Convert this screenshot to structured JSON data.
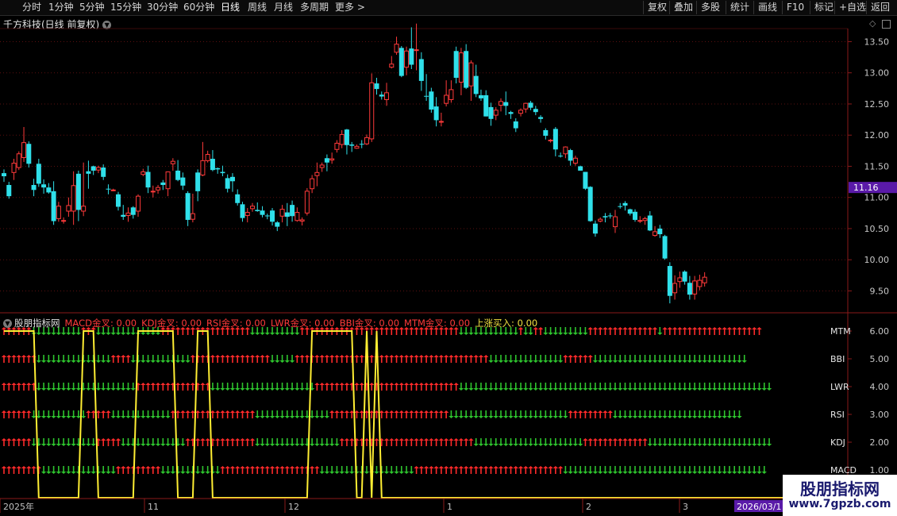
{
  "tabs": [
    {
      "label": "分时",
      "x": 28
    },
    {
      "label": "1分钟",
      "x": 61
    },
    {
      "label": "5分钟",
      "x": 100
    },
    {
      "label": "15分钟",
      "x": 139
    },
    {
      "label": "30分钟",
      "x": 185
    },
    {
      "label": "60分钟",
      "x": 231
    },
    {
      "label": "日线",
      "x": 278,
      "active": true
    },
    {
      "label": "周线",
      "x": 312
    },
    {
      "label": "月线",
      "x": 345
    },
    {
      "label": "多周期",
      "x": 378
    },
    {
      "label": "更多 >",
      "x": 422
    }
  ],
  "toolbar": [
    {
      "label": "复权",
      "x": 816
    },
    {
      "label": "叠加",
      "x": 849
    },
    {
      "label": "多股",
      "x": 883
    },
    {
      "label": "统计",
      "x": 920
    },
    {
      "label": "画线",
      "x": 955
    },
    {
      "label": "F10",
      "x": 991
    },
    {
      "label": "标记",
      "x": 1026
    },
    {
      "label": "+自选",
      "x": 1057
    },
    {
      "label": "返回",
      "x": 1097
    }
  ],
  "stock_title": "千方科技(日线 前复权)",
  "price_axis": [
    "13.50",
    "13.00",
    "12.50",
    "12.00",
    "11.50",
    "11.00",
    "10.50",
    "10.00",
    "9.50"
  ],
  "current_price": "11.16",
  "indicator": {
    "name": "股朋指标网",
    "fields": [
      {
        "label": "MACD金叉: 0.00",
        "color": "#ff3a3a"
      },
      {
        "label": "KDJ金叉: 0.00",
        "color": "#ff3a3a"
      },
      {
        "label": "RSI金叉: 0.00",
        "color": "#ff3a3a"
      },
      {
        "label": "LWR金叉: 0.00",
        "color": "#ff3a3a"
      },
      {
        "label": "BBI金叉: 0.00",
        "color": "#ff3a3a"
      },
      {
        "label": "MTM金叉: 0.00",
        "color": "#ff3a3a"
      },
      {
        "label": "上涨买入: 0.00",
        "color": "#f0e040"
      }
    ],
    "axis": [
      "6.00",
      "5.00",
      "4.00",
      "3.00",
      "2.00",
      "1.00"
    ],
    "row_labels": [
      "MTM",
      "BBI",
      "LWR",
      "RSI",
      "KDJ",
      "MACD"
    ]
  },
  "date_axis": [
    {
      "label": "2025年",
      "x": 4
    },
    {
      "label": "11",
      "x": 186
    },
    {
      "label": "12",
      "x": 363
    },
    {
      "label": "1",
      "x": 563
    },
    {
      "label": "2",
      "x": 738
    },
    {
      "label": "3",
      "x": 860
    }
  ],
  "date_highlight": "2026/03/1",
  "watermark": {
    "line1": "股朋指标网",
    "line2": "www.7gpzb.com"
  },
  "colors": {
    "up": "#ff3a3a",
    "down": "#2fe0ea",
    "arrow_up": "#ff2a2a",
    "arrow_down": "#2ec42e",
    "signal": "#ffee33",
    "grid": "#5a0f0f",
    "price_tag": "#5a1aa8"
  },
  "chart_data": {
    "type": "candlestick",
    "ylim": [
      9.2,
      13.85
    ],
    "candles": [
      [
        11.39,
        11.34,
        11.45,
        11.25
      ],
      [
        11.2,
        11.02,
        11.25,
        10.98
      ],
      [
        11.4,
        11.55,
        11.62,
        11.28
      ],
      [
        11.48,
        11.7,
        11.74,
        11.44
      ],
      [
        11.64,
        11.88,
        12.13,
        11.57
      ],
      [
        11.86,
        11.54,
        11.9,
        11.48
      ],
      [
        11.2,
        11.12,
        11.3,
        11.02
      ],
      [
        11.54,
        11.22,
        11.62,
        11.17
      ],
      [
        11.21,
        11.16,
        11.29,
        11.06
      ],
      [
        11.16,
        11.08,
        11.23,
        11.06
      ],
      [
        11.1,
        10.62,
        11.26,
        10.56
      ],
      [
        10.66,
        10.86,
        10.93,
        10.61
      ],
      [
        10.62,
        10.63,
        10.68,
        10.58
      ],
      [
        10.78,
        10.87,
        11.0,
        10.69
      ],
      [
        10.78,
        11.19,
        11.42,
        10.56
      ],
      [
        11.38,
        10.8,
        11.43,
        10.62
      ],
      [
        10.78,
        10.86,
        11.56,
        10.7
      ],
      [
        11.42,
        11.38,
        11.59,
        11.14
      ],
      [
        11.5,
        11.43,
        11.51,
        11.36
      ],
      [
        11.44,
        11.48,
        11.51,
        11.39
      ],
      [
        11.48,
        11.33,
        11.53,
        11.28
      ],
      [
        11.14,
        11.13,
        11.21,
        11.05
      ],
      [
        11.12,
        11.12,
        11.14,
        11.1
      ],
      [
        11.05,
        10.85,
        11.09,
        10.79
      ],
      [
        10.72,
        10.69,
        10.88,
        10.64
      ],
      [
        10.71,
        10.75,
        10.84,
        10.61
      ],
      [
        10.84,
        10.72,
        10.86,
        10.66
      ],
      [
        10.78,
        11.02,
        11.05,
        10.69
      ],
      [
        11.37,
        11.41,
        11.46,
        11.34
      ],
      [
        11.41,
        11.16,
        11.51,
        11.07
      ],
      [
        11.09,
        11.1,
        11.19,
        11.0
      ],
      [
        11.12,
        11.16,
        11.2,
        11.06
      ],
      [
        11.24,
        11.2,
        11.28,
        11.12
      ],
      [
        11.14,
        11.41,
        11.41,
        11.02
      ],
      [
        11.54,
        11.58,
        11.63,
        11.43
      ],
      [
        11.43,
        11.28,
        11.6,
        11.26
      ],
      [
        11.32,
        11.19,
        11.4,
        11.12
      ],
      [
        11.07,
        10.64,
        11.1,
        10.54
      ],
      [
        10.65,
        10.74,
        11.06,
        10.6
      ],
      [
        11.4,
        11.1,
        11.45,
        10.94
      ],
      [
        11.36,
        11.59,
        11.89,
        11.34
      ],
      [
        11.59,
        11.69,
        11.75,
        11.56
      ],
      [
        11.62,
        11.44,
        11.76,
        11.42
      ],
      [
        11.47,
        11.45,
        11.48,
        11.38
      ],
      [
        11.41,
        11.39,
        11.51,
        11.34
      ],
      [
        11.31,
        11.14,
        11.37,
        11.08
      ],
      [
        11.33,
        11.26,
        11.39,
        11.09
      ],
      [
        11.05,
        10.91,
        11.13,
        10.87
      ],
      [
        10.89,
        10.67,
        10.93,
        10.61
      ],
      [
        10.71,
        10.76,
        10.83,
        10.6
      ],
      [
        10.82,
        10.86,
        10.91,
        10.77
      ],
      [
        10.8,
        10.78,
        10.92,
        10.77
      ],
      [
        10.79,
        10.72,
        10.86,
        10.68
      ],
      [
        10.71,
        10.7,
        10.74,
        10.65
      ],
      [
        10.79,
        10.61,
        10.83,
        10.55
      ],
      [
        10.6,
        10.53,
        10.62,
        10.46
      ],
      [
        10.7,
        10.81,
        10.88,
        10.6
      ],
      [
        10.76,
        10.69,
        10.91,
        10.54
      ],
      [
        10.88,
        10.7,
        10.95,
        10.61
      ],
      [
        10.63,
        10.76,
        10.84,
        10.61
      ],
      [
        10.62,
        10.64,
        10.68,
        10.55
      ],
      [
        10.75,
        11.1,
        11.15,
        10.71
      ],
      [
        11.14,
        11.3,
        11.36,
        11.07
      ],
      [
        11.35,
        11.4,
        11.56,
        11.18
      ],
      [
        11.48,
        11.52,
        11.56,
        11.41
      ],
      [
        11.63,
        11.56,
        11.69,
        11.42
      ],
      [
        11.6,
        11.62,
        11.72,
        11.54
      ],
      [
        11.77,
        11.87,
        11.92,
        11.72
      ],
      [
        11.85,
        12.01,
        12.08,
        11.79
      ],
      [
        12.09,
        11.84,
        12.1,
        11.69
      ],
      [
        11.85,
        11.83,
        11.89,
        11.73
      ],
      [
        11.79,
        11.82,
        11.85,
        11.78
      ],
      [
        11.86,
        11.85,
        11.92,
        11.79
      ],
      [
        11.86,
        11.96,
        12.01,
        11.84
      ],
      [
        11.94,
        12.84,
        12.99,
        11.89
      ],
      [
        12.83,
        12.74,
        12.92,
        12.65
      ],
      [
        12.65,
        12.62,
        12.7,
        12.57
      ],
      [
        12.57,
        12.68,
        12.84,
        12.47
      ],
      [
        13.09,
        13.14,
        13.27,
        13.07
      ],
      [
        13.33,
        13.46,
        13.58,
        13.29
      ],
      [
        13.4,
        12.95,
        13.43,
        12.93
      ],
      [
        13.09,
        13.35,
        13.42,
        12.96
      ],
      [
        13.39,
        13.13,
        13.73,
        13.06
      ],
      [
        13.37,
        13.37,
        13.79,
        13.04
      ],
      [
        13.22,
        12.87,
        13.33,
        12.71
      ],
      [
        12.63,
        12.62,
        12.98,
        12.55
      ],
      [
        12.7,
        12.41,
        12.76,
        12.36
      ],
      [
        12.46,
        12.24,
        12.61,
        12.14
      ],
      [
        12.21,
        12.22,
        12.36,
        12.14
      ],
      [
        12.51,
        12.64,
        12.88,
        12.46
      ],
      [
        12.57,
        12.73,
        12.88,
        12.52
      ],
      [
        13.35,
        12.92,
        13.42,
        12.83
      ],
      [
        12.85,
        13.32,
        13.4,
        12.64
      ],
      [
        13.35,
        12.76,
        13.46,
        12.74
      ],
      [
        12.79,
        13.16,
        13.2,
        12.55
      ],
      [
        12.95,
        12.66,
        13.13,
        12.61
      ],
      [
        12.64,
        12.59,
        12.73,
        12.55
      ],
      [
        12.64,
        12.3,
        12.72,
        12.3
      ],
      [
        12.45,
        12.26,
        12.52,
        12.15
      ],
      [
        12.32,
        12.4,
        12.45,
        12.24
      ],
      [
        12.48,
        12.54,
        12.59,
        12.38
      ],
      [
        12.53,
        12.47,
        12.7,
        12.32
      ],
      [
        12.37,
        12.34,
        12.39,
        12.26
      ],
      [
        12.22,
        12.11,
        12.27,
        12.05
      ],
      [
        12.35,
        12.4,
        12.43,
        12.3
      ],
      [
        12.42,
        12.51,
        12.52,
        12.36
      ],
      [
        12.52,
        12.44,
        12.55,
        12.4
      ],
      [
        12.42,
        12.37,
        12.47,
        12.32
      ],
      [
        12.29,
        12.26,
        12.32,
        12.2
      ],
      [
        12.08,
        11.99,
        12.11,
        11.93
      ],
      [
        11.91,
        11.92,
        11.94,
        11.88
      ],
      [
        12.1,
        11.77,
        12.13,
        11.66
      ],
      [
        11.67,
        11.66,
        11.72,
        11.64
      ],
      [
        11.7,
        11.81,
        11.82,
        11.63
      ],
      [
        11.76,
        11.59,
        11.78,
        11.51
      ],
      [
        11.55,
        11.63,
        11.67,
        11.51
      ],
      [
        11.5,
        11.43,
        11.51,
        11.43
      ],
      [
        11.41,
        11.14,
        11.41,
        11.12
      ],
      [
        11.17,
        10.62,
        11.18,
        10.61
      ],
      [
        10.58,
        10.42,
        10.63,
        10.37
      ],
      [
        10.62,
        10.65,
        10.68,
        10.6
      ],
      [
        10.7,
        10.68,
        10.75,
        10.6
      ],
      [
        10.71,
        10.7,
        10.75,
        10.66
      ],
      [
        10.53,
        10.69,
        10.8,
        10.43
      ],
      [
        10.86,
        10.85,
        10.91,
        10.82
      ],
      [
        10.91,
        10.87,
        10.94,
        10.79
      ],
      [
        10.81,
        10.74,
        10.82,
        10.71
      ],
      [
        10.77,
        10.64,
        10.81,
        10.61
      ],
      [
        10.62,
        10.63,
        10.7,
        10.59
      ],
      [
        10.63,
        10.66,
        10.69,
        10.56
      ],
      [
        10.71,
        10.47,
        10.78,
        10.46
      ],
      [
        10.39,
        10.45,
        10.54,
        10.37
      ],
      [
        10.5,
        10.41,
        10.56,
        10.35
      ],
      [
        10.38,
        10.02,
        10.4,
        10.0
      ],
      [
        9.9,
        9.42,
        9.96,
        9.3
      ],
      [
        9.47,
        9.62,
        9.75,
        9.36
      ],
      [
        9.65,
        9.71,
        9.81,
        9.55
      ],
      [
        9.81,
        9.65,
        9.83,
        9.6
      ],
      [
        9.63,
        9.44,
        9.74,
        9.36
      ],
      [
        9.45,
        9.66,
        9.74,
        9.36
      ],
      [
        9.57,
        9.67,
        9.76,
        9.51
      ],
      [
        9.63,
        9.72,
        9.8,
        9.57
      ]
    ]
  },
  "signals": {
    "rows": [
      {
        "name": "MTM",
        "arrows": "UUUUUUDDDDDDDDDDUUUDDDDDDDDDDDDDUUUUUUUUUUUUUUUUUUDDDDDDDDDDUUUUUUUUUUUUUUUUUUUUUUUUUUUUUUUUDDDDDDDDDDDDUDDUUDDDDDDDDDUUUUUUUUUUUUUUDUUUUUUUUUUUUUUUUUUUU"
      },
      {
        "name": "BBI",
        "arrows": "UUUUUUUDDDDDDDDDDDDDDDUUUUDDDDDDDDDDDDUUUUUUUUUUUUUUUUDDDDDUUUUUUUUUUUUUUUUUUUUUUUUUUUUUUUUUUUUUUUDDDDDDDDDDDDDDDUUUUUUDDDDDDDDDDDDDDDDDDDDDDDDDDDDDDD"
      },
      {
        "name": "LWR",
        "arrows": "UUUUUUUDDDDDDDDDDDDDDDDDDDDUUUUUUUUUUUUUUUDDDDDDDDDDDDDDDDDDDDDUUUUUUUUUUUUUUUUUUUUUUUUUUUUUDDDDDDDDDDDDDDDDDDDDDDDDDDDDDDDDDDDDDDDDDDDDDDDDDDDDDDDDDDDDDDD"
      },
      {
        "name": "RSI",
        "arrows": "UUUUUUDDDDDDDDDDDUUUUUDDDDDDDDDDDDUUUUUUUUUUUUUUUUUDDDDDDDDDDDDDDDUUUUUUUUUUUUUUUUUUUUUUUUDDDDDDDDDDDDDDDDDDDDDDDDUUUUUUUUUDDDDDDDDDDDDDDDDDDDDDDDDDD"
      },
      {
        "name": "KDJ",
        "arrows": "UUUUUUDDDDDDDDDDDDDUUUUUDDDDDDDDDDDDDUUUUUUUUUUUUUUDDDDDDDDDDDDDDDDDUUUUUUUUUUUUUUUUUUUUUUUUUUUDDDDDDDDDDDDDDDDDDDDDDUUUUUUUUUUUUUDDDDDDDDDDDDDDDDDDDDDDDDD"
      },
      {
        "name": "MACD",
        "arrows": "UUUUUUUUDDDDDDDDDDDDDDDUUUUUUUUUDDDDDDDDDDDDUUUUUUUUUUUUUUUUUUUUDDDDDDDDDDDDDDDDDDDUUUUUUUUUUUUUUUUUUUUUUUUUUUUUUDDDDDDDDDDDDDDDDDDDDDDDDDDDDDDDDDDDDDDDDD"
      }
    ],
    "buy_signal": [
      6,
      6,
      6,
      6,
      6,
      6,
      6,
      0,
      0,
      0,
      0,
      0,
      0,
      0,
      0,
      0,
      6,
      6,
      6,
      0,
      0,
      0,
      0,
      0,
      0,
      0,
      0,
      6,
      6,
      6,
      6,
      6,
      6,
      6,
      6,
      0,
      0,
      0,
      0,
      6,
      6,
      6,
      0,
      0,
      0,
      0,
      0,
      0,
      0,
      0,
      0,
      0,
      0,
      0,
      0,
      0,
      0,
      0,
      0,
      0,
      0,
      0,
      6,
      6,
      6,
      6,
      6,
      6,
      6,
      6,
      6,
      0,
      0,
      6,
      0,
      6,
      0,
      0,
      0,
      0,
      0,
      0,
      0,
      0,
      0,
      0,
      0,
      0,
      0,
      0,
      0,
      0,
      0,
      0,
      0,
      0,
      0,
      0,
      0,
      0,
      0,
      0,
      0,
      0,
      0,
      0,
      0,
      0,
      0,
      0,
      0,
      0,
      0,
      0,
      0,
      0,
      0,
      0,
      0,
      0,
      0,
      0,
      0,
      0,
      0,
      0,
      0,
      0,
      0,
      0,
      0,
      0,
      0,
      0,
      0,
      0,
      0,
      0,
      0,
      0,
      0,
      0,
      0,
      0,
      0,
      0,
      0,
      0,
      0,
      0
    ]
  }
}
